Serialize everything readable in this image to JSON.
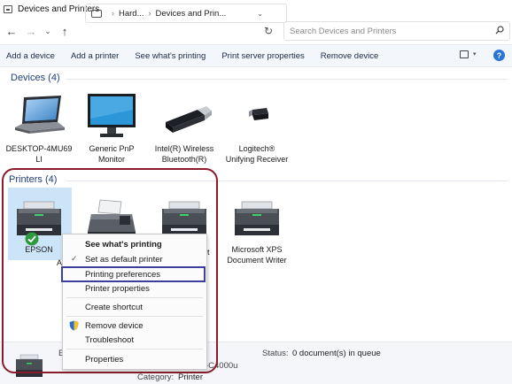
{
  "window": {
    "title": "Devices and Printers"
  },
  "address": {
    "breadcrumb": [
      "Hard...",
      "Devices and Prin..."
    ],
    "search_placeholder": "Search Devices and Printers"
  },
  "commands": [
    "Add a device",
    "Add a printer",
    "See what's printing",
    "Print server properties",
    "Remove device"
  ],
  "devices_group": {
    "header": "Devices (4)",
    "items": [
      {
        "label": "DESKTOP-4MU69\nLI",
        "icon": "laptop-icon"
      },
      {
        "label": "Generic PnP\nMonitor",
        "icon": "monitor-icon"
      },
      {
        "label": "Intel(R) Wireless\nBluetooth(R)",
        "icon": "usb-dongle-icon"
      },
      {
        "label": "Logitech®\nUnifying Receiver",
        "icon": "usb-receiver-icon"
      }
    ]
  },
  "printers_group": {
    "header": "Printers (4)",
    "items": [
      {
        "label": "EPSON",
        "icon": "printer-icon",
        "default": true,
        "selected": true
      },
      {
        "label": "",
        "icon": "fax-icon"
      },
      {
        "label": "",
        "icon": "printer-icon"
      },
      {
        "label": "Microsoft XPS\nDocument Writer",
        "icon": "printer-icon"
      }
    ],
    "obscured_fragments": {
      "under_menu_1": "A",
      "under_menu_2": "t"
    }
  },
  "context_menu": {
    "items": [
      {
        "label": "See what's printing",
        "bold": true
      },
      {
        "label": "Set as default printer",
        "checked": true
      },
      {
        "label": "Printing preferences",
        "highlighted": true
      },
      {
        "label": "Printer properties"
      },
      {
        "label": "Create shortcut"
      },
      {
        "label": "Remove device",
        "icon": "shield-icon"
      },
      {
        "label": "Troubleshoot"
      },
      {
        "label": "Properties"
      }
    ]
  },
  "details": {
    "name_fragment": "E",
    "model_fragment": "-C4000u",
    "status_label": "Status:",
    "status_value": "0 document(s) in queue",
    "category_label": "Category:",
    "category_value": "Printer"
  },
  "colors": {
    "accent": "#1e3d7a",
    "selection": "#cce4f7",
    "annotation_red": "#8b1b2c",
    "annotation_blue": "#3d3fa0",
    "default_badge": "#2e9a3e",
    "help": "#2a72d6"
  }
}
